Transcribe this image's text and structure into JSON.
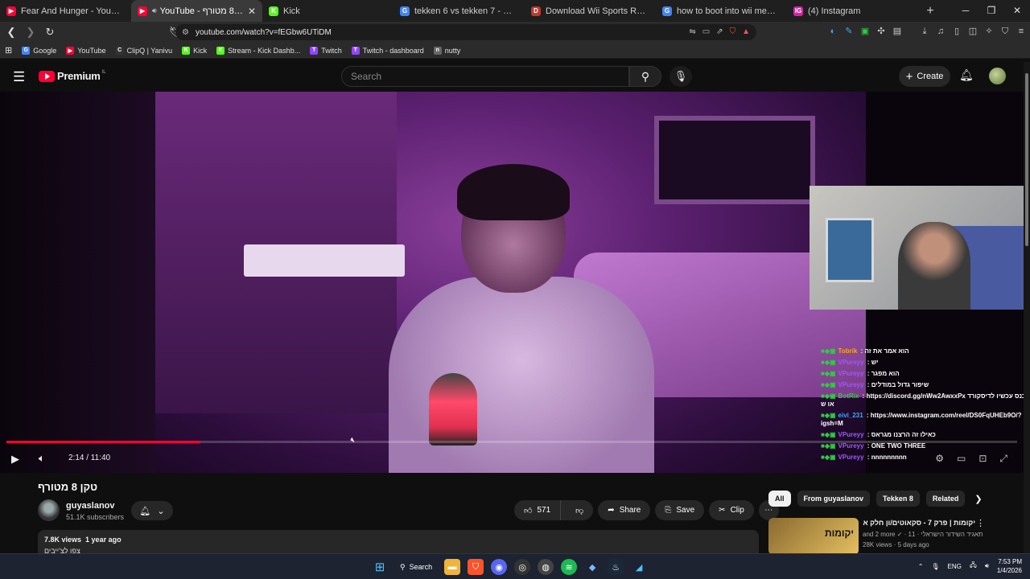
{
  "browser": {
    "tabs": [
      {
        "label": "Fear And Hunger - YouTube",
        "fav": "yt",
        "color": "#ff0033"
      },
      {
        "label": "YouTube - טקן 8 מטורף",
        "fav": "yt",
        "color": "#ff0033",
        "active": true
      },
      {
        "label": "Kick",
        "fav": "K",
        "color": "#53fc18"
      },
      {
        "label": "tekken 6 vs tekken 7 - Google Search",
        "fav": "G",
        "color": "#4285f4"
      },
      {
        "label": "Download Wii Sports Resort ROM - F",
        "fav": "D",
        "color": "#c0392b"
      },
      {
        "label": "how to boot into wii menu dolphin",
        "fav": "G",
        "color": "#4285f4"
      },
      {
        "label": "(4) Instagram",
        "fav": "IG",
        "color": "#d6249f"
      }
    ],
    "url": "youtube.com/watch?v=fEGbw6UTiDM",
    "bookmarks": [
      {
        "label": "Google",
        "icon": "G",
        "color": "#4285f4"
      },
      {
        "label": "YouTube",
        "icon": "▶",
        "color": "#ff0033"
      },
      {
        "label": "ClipQ | Yanivu",
        "icon": "C",
        "color": "#333"
      },
      {
        "label": "Kick",
        "icon": "K",
        "color": "#53fc18"
      },
      {
        "label": "Stream - Kick Dashb...",
        "icon": "K",
        "color": "#53fc18"
      },
      {
        "label": "Twitch",
        "icon": "T",
        "color": "#9146ff"
      },
      {
        "label": "Twitch - dashboard",
        "icon": "T",
        "color": "#9146ff"
      },
      {
        "label": "nutty",
        "icon": "n",
        "color": "#666"
      }
    ]
  },
  "yt": {
    "brand": "Premium",
    "region": "IL",
    "search_placeholder": "Search",
    "create_label": "Create"
  },
  "player": {
    "time": "2:14 / 11:40",
    "progress": 0.192,
    "chat": [
      {
        "user": "Tobrik",
        "color": "#f5a623",
        "text": "הוא אמר את זה"
      },
      {
        "user": "VPureyy",
        "color": "#9b59ff",
        "text": "יש"
      },
      {
        "user": "VPureyy",
        "color": "#9b59ff",
        "text": "הוא מפגר"
      },
      {
        "user": "VPureyy",
        "color": "#9b59ff",
        "text": "שיפור גדול במודלים"
      },
      {
        "user": "BotRix",
        "color": "#2ecc40",
        "text": "https://discord.gg/nWw2AwxxPx כנס עכשיו לדיסקורד או ש"
      },
      {
        "user": "eivi_231",
        "color": "#3fa9f5",
        "text": "https://www.instagram.com/reel/DS0FqUHEb9O/?igsh=M"
      },
      {
        "user": "VPureyy",
        "color": "#9b59ff",
        "text": "כאילו זה הרצנו מגראס"
      },
      {
        "user": "VPureyy",
        "color": "#9b59ff",
        "text": "ONE TWO THREE"
      },
      {
        "user": "VPureyy",
        "color": "#9b59ff",
        "text": "nnnnnnnnn"
      }
    ]
  },
  "video": {
    "title": "טקן 8 מטורף",
    "channel": "guyaslanov",
    "subscribers": "51.1K subscribers",
    "likes": "571",
    "share": "Share",
    "save": "Save",
    "clip": "Clip",
    "views": "7.8K views",
    "age": "1 year ago",
    "desc_line": "צפו לצ'ייבים"
  },
  "sidebar": {
    "chips": [
      "All",
      "From guyaslanov",
      "Tekken 8",
      "Related"
    ],
    "rec": {
      "thumb_text": "יקומות",
      "title": "יקומות | פרק 7 - סקאוטים/ון חלק א",
      "channel": "and 2 more ✓ · תאגיד השידור הישראלי · 11",
      "meta": "28K views · 5 days ago"
    }
  },
  "taskbar": {
    "search": "Search",
    "lang": "ENG",
    "time": "7:53 PM",
    "date": "1/4/2026"
  }
}
